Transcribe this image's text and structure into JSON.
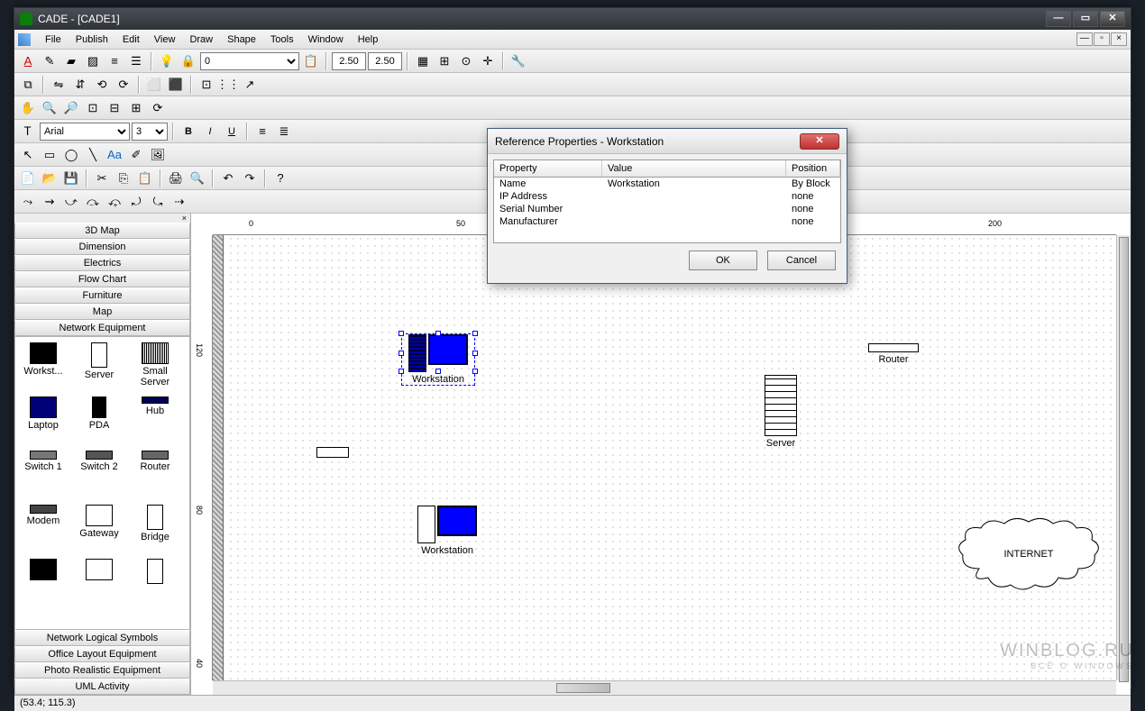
{
  "title": "CADE - [CADE1]",
  "menu": [
    "File",
    "Publish",
    "Edit",
    "View",
    "Draw",
    "Shape",
    "Tools",
    "Window",
    "Help"
  ],
  "grid_w": "2.50",
  "grid_h": "2.50",
  "layer_combo": "0",
  "font_name": "Arial",
  "font_size": "3",
  "categories": [
    "3D Map",
    "Dimension",
    "Electrics",
    "Flow Chart",
    "Furniture",
    "Map",
    "Network Equipment"
  ],
  "categories_after": [
    "Network Logical Symbols",
    "Office Layout Equipment",
    "Photo Realistic Equipment",
    "UML Activity"
  ],
  "palette": [
    "Workst...",
    "Server",
    "Small Server",
    "Laptop",
    "PDA",
    "Hub",
    "Switch 1",
    "Switch 2",
    "Router",
    "Modem",
    "Gateway",
    "Bridge"
  ],
  "ruler_h": [
    "0",
    "50",
    "200"
  ],
  "ruler_v": [
    "120",
    "80",
    "40"
  ],
  "canvas_objects": {
    "ws1": "Workstation",
    "ws2": "Workstation",
    "server": "Server",
    "router": "Router",
    "internet": "INTERNET"
  },
  "dialog": {
    "title": "Reference Properties - Workstation",
    "headers": [
      "Property",
      "Value",
      "Position"
    ],
    "rows": [
      {
        "prop": "Name",
        "val": "Workstation",
        "pos": "By Block"
      },
      {
        "prop": "IP Address",
        "val": "",
        "pos": "none"
      },
      {
        "prop": "Serial Number",
        "val": "",
        "pos": "none"
      },
      {
        "prop": "Manufacturer",
        "val": "",
        "pos": "none"
      }
    ],
    "ok": "OK",
    "cancel": "Cancel"
  },
  "status": "(53.4; 115.3)",
  "watermark": {
    "big": "WINBLOG.RU",
    "small": "ВСЁ О WINDOWS"
  }
}
